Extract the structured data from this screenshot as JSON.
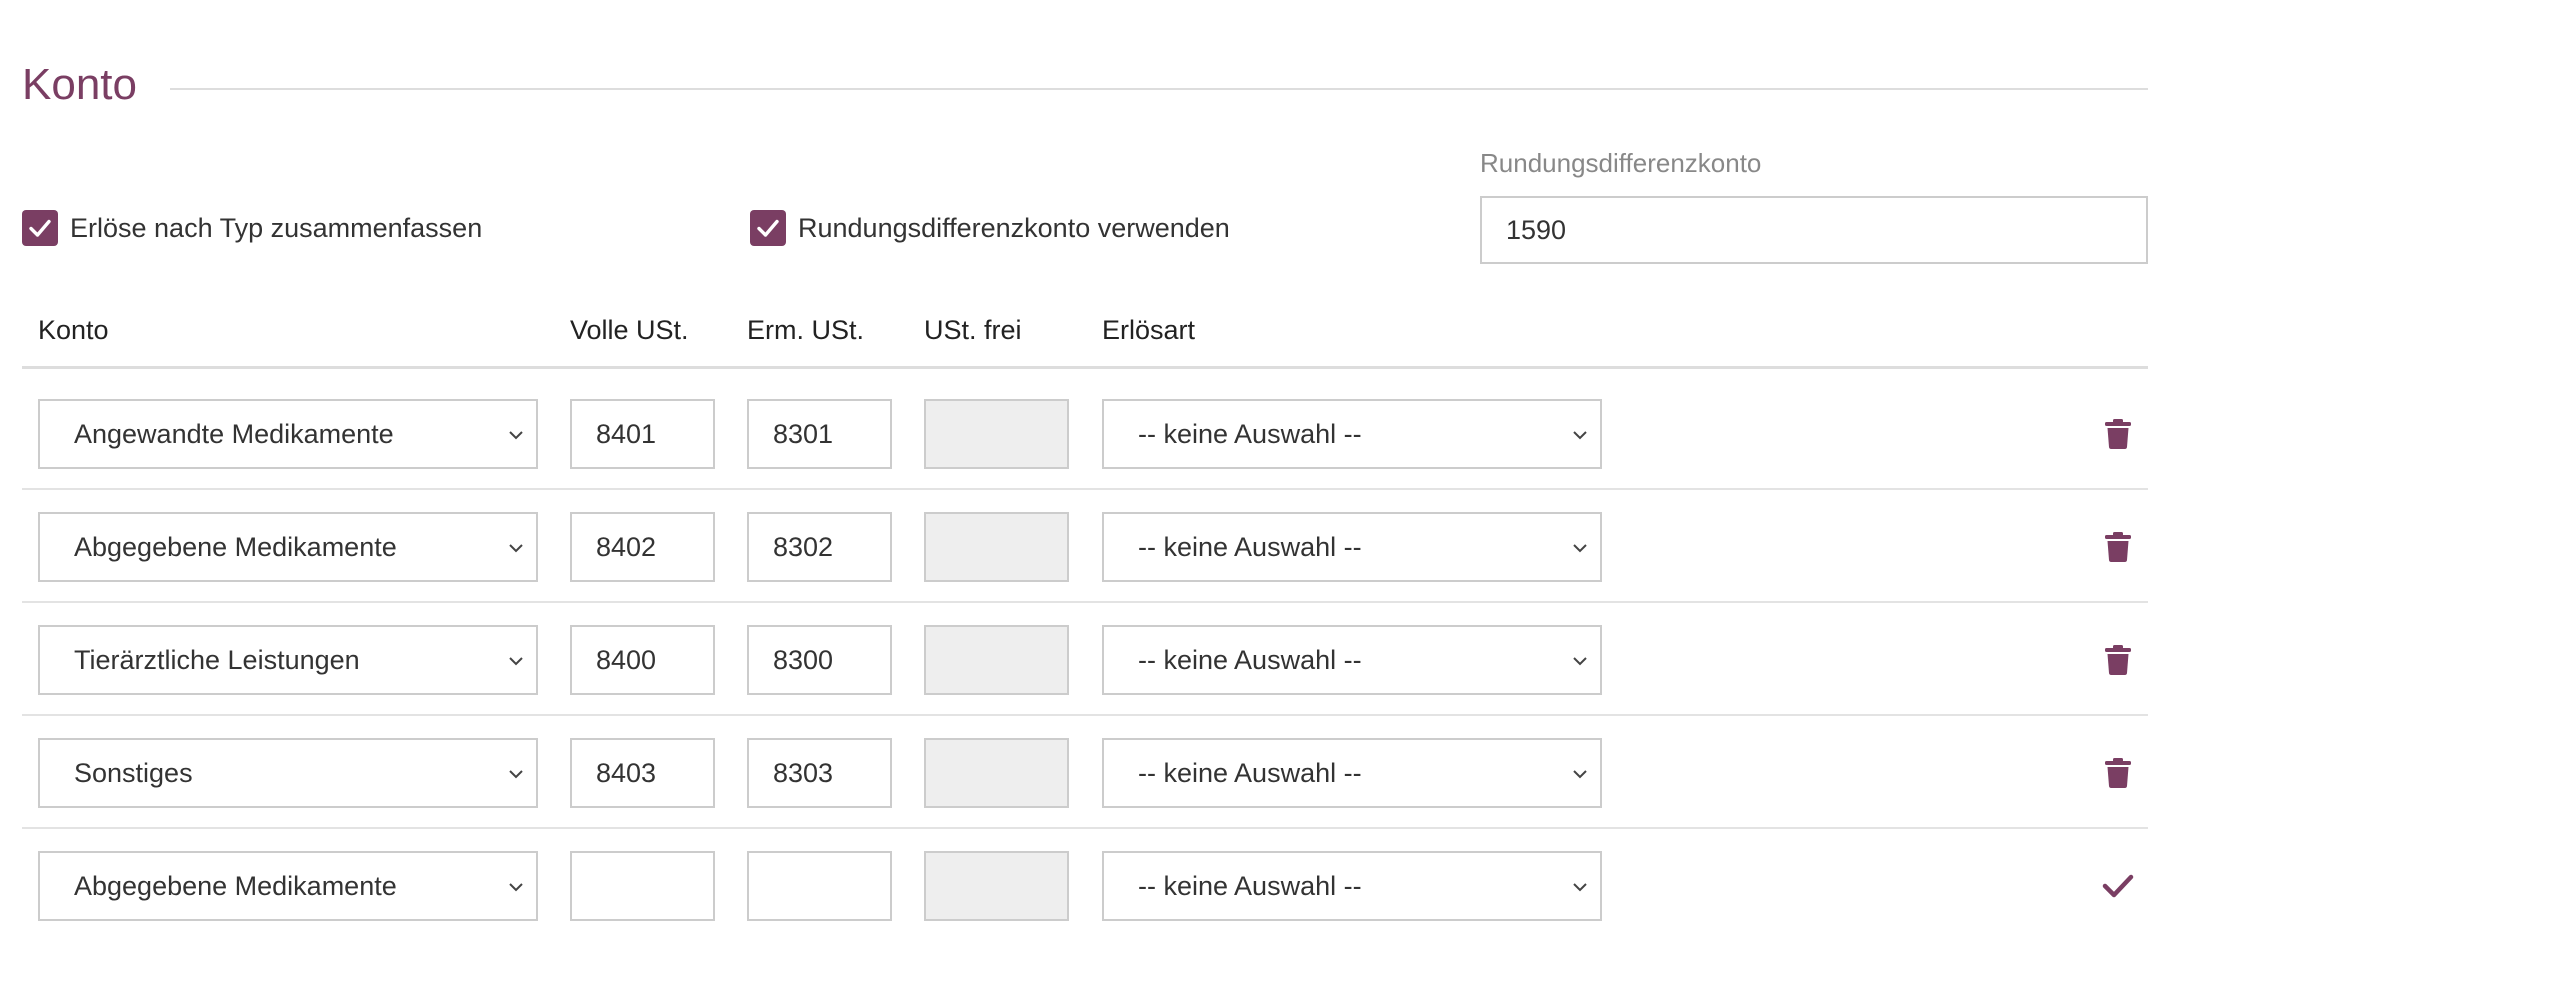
{
  "section": {
    "title": "Konto"
  },
  "options": {
    "summarize_by_type": {
      "label": "Erlöse nach Typ zusammenfassen",
      "checked": true
    },
    "use_rounding_account": {
      "label": "Rundungsdifferenzkonto verwenden",
      "checked": true
    }
  },
  "rounding_account": {
    "label": "Rundungsdifferenzkonto",
    "value": "1590"
  },
  "table": {
    "headers": {
      "konto": "Konto",
      "full_vat": "Volle USt.",
      "reduced_vat": "Erm. USt.",
      "vat_free": "USt. frei",
      "revenue_type": "Erlösart"
    },
    "rows": [
      {
        "konto": "Angewandte Medikamente",
        "full_vat": "8401",
        "reduced_vat": "8301",
        "vat_free": "",
        "revenue_type": "-- keine Auswahl --",
        "action": "trash-icon"
      },
      {
        "konto": "Abgegebene Medikamente",
        "full_vat": "8402",
        "reduced_vat": "8302",
        "vat_free": "",
        "revenue_type": "-- keine Auswahl --",
        "action": "trash-icon"
      },
      {
        "konto": "Tierärztliche Leistungen",
        "full_vat": "8400",
        "reduced_vat": "8300",
        "vat_free": "",
        "revenue_type": "-- keine Auswahl --",
        "action": "trash-icon"
      },
      {
        "konto": "Sonstiges",
        "full_vat": "8403",
        "reduced_vat": "8303",
        "vat_free": "",
        "revenue_type": "-- keine Auswahl --",
        "action": "trash-icon"
      },
      {
        "konto": "Abgegebene Medikamente",
        "full_vat": "",
        "reduced_vat": "",
        "vat_free": "",
        "revenue_type": "-- keine Auswahl --",
        "action": "check-icon"
      }
    ]
  },
  "colors": {
    "accent": "#7a3e63",
    "border": "#cccccc",
    "disabled_bg": "#eeeeee"
  }
}
